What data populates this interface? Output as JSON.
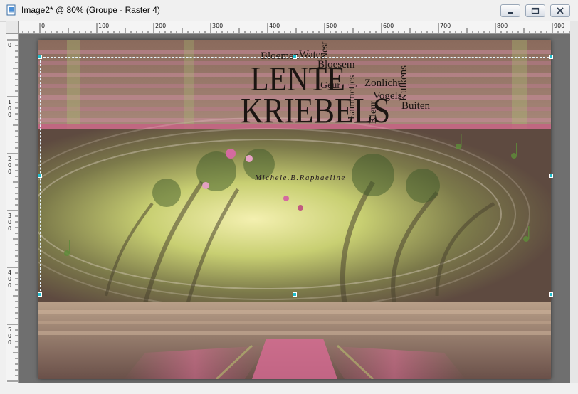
{
  "window": {
    "title": "Image2* @  80% (Groupe - Raster 4)",
    "buttons": [
      "minimize",
      "maximize",
      "close"
    ]
  },
  "ruler": {
    "top_labels": [
      "0",
      "100",
      "200",
      "300",
      "400",
      "500",
      "600",
      "700",
      "800",
      "900"
    ],
    "left_labels": [
      [
        "0"
      ],
      [
        "1",
        "0",
        "0"
      ],
      [
        "2",
        "0",
        "0"
      ],
      [
        "3",
        "0",
        "0"
      ],
      [
        "4",
        "0",
        "0"
      ],
      [
        "5",
        "0",
        "0"
      ]
    ]
  },
  "artwork": {
    "words": {
      "bloemen": "Bloemen",
      "water": "Water",
      "nest": "Nest",
      "bloesem": "Bloesem",
      "lente": "LENTE",
      "kriebels": "KRIEBELS",
      "geur": "Geur",
      "lammetjes": "Lammetjes",
      "zonlicht": "Zonlicht",
      "vogels": "Vogels",
      "kuikens": "Kuikens",
      "kleur": "Kleur",
      "buiten": "Buiten"
    },
    "signature": "Michele.B.Raphaeline"
  },
  "colors": {
    "canvas_bg": "#6f6f6f",
    "rose": "#b85a78",
    "olive_light": "#d8e08a",
    "brown": "#6f5148",
    "selection_handle": "#20c0d0"
  }
}
